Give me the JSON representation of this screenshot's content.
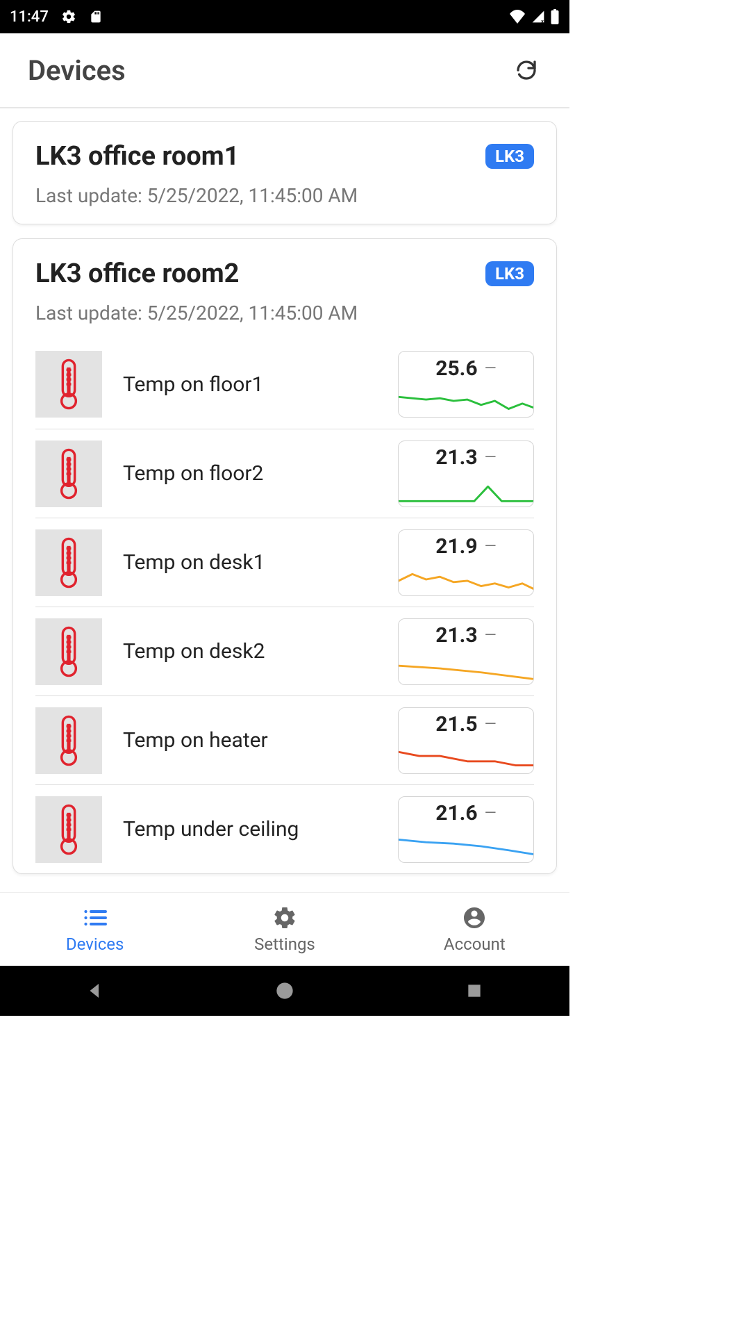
{
  "status_bar": {
    "time": "11:47"
  },
  "header": {
    "title": "Devices"
  },
  "card1": {
    "title": "LK3 office room1",
    "badge": "LK3",
    "subtitle": "Last update: 5/25/2022, 11:45:00 AM"
  },
  "card2": {
    "title": "LK3 office room2",
    "badge": "LK3",
    "subtitle": "Last update: 5/25/2022, 11:45:00 AM",
    "sensors": [
      {
        "label": "Temp on floor1",
        "value": "25.6",
        "trend": "—",
        "color": "#2abf3c"
      },
      {
        "label": "Temp on floor2",
        "value": "21.3",
        "trend": "—",
        "color": "#2abf3c"
      },
      {
        "label": "Temp on desk1",
        "value": "21.9",
        "trend": "—",
        "color": "#f5a623"
      },
      {
        "label": "Temp on desk2",
        "value": "21.3",
        "trend": "—",
        "color": "#f5a623"
      },
      {
        "label": "Temp on heater",
        "value": "21.5",
        "trend": "—",
        "color": "#e84a1f"
      },
      {
        "label": "Temp under ceiling",
        "value": "21.6",
        "trend": "—",
        "color": "#3aa2f2"
      }
    ]
  },
  "tabs": {
    "devices": "Devices",
    "settings": "Settings",
    "account": "Account"
  },
  "spark_shapes": [
    "0,18 20,20 40,22 60,20 80,24 100,22 120,30 140,24 160,36 180,28 196,34",
    "0,40 30,40 60,40 90,40 110,40 130,18 150,40 196,40",
    "0,26 20,16 40,24 60,20 80,28 100,26 120,34 140,30 160,36 180,30 196,38",
    "0,20 60,24 120,30 196,40",
    "0,16 30,22 60,22 100,30 140,30 170,36 196,36",
    "0,14 40,18 80,20 120,24 160,30 196,36"
  ]
}
